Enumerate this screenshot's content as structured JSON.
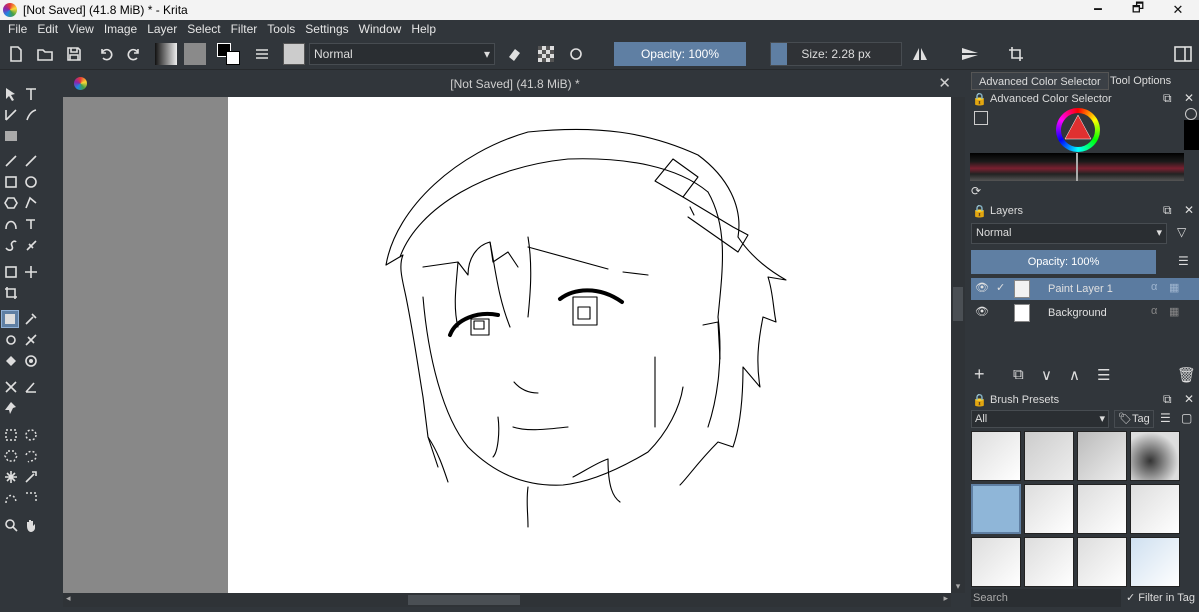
{
  "window": {
    "title": "[Not Saved]  (41.8 MiB) * - Krita",
    "minimize": "🗕",
    "maximize": "🗗",
    "close": "✕"
  },
  "menu": [
    "File",
    "Edit",
    "View",
    "Image",
    "Layer",
    "Select",
    "Filter",
    "Tools",
    "Settings",
    "Window",
    "Help"
  ],
  "toolbar": {
    "blend_mode": "Normal",
    "opacity_label": "Opacity: 100%",
    "opacity_value": 100,
    "size_label": "Size: 2.28 px"
  },
  "document": {
    "tab_title": "[Not Saved]  (41.8 MiB) *",
    "close": "✕"
  },
  "dock_tabs": [
    "Advanced Color Selector",
    "Tool Options"
  ],
  "color_selector": {
    "title": "Advanced Color Selector"
  },
  "layers": {
    "title": "Layers",
    "blend_mode": "Normal",
    "opacity_label": "Opacity: 100%",
    "items": [
      {
        "name": "Paint Layer 1",
        "selected": true
      },
      {
        "name": "Background",
        "selected": false
      }
    ]
  },
  "brush_presets": {
    "title": "Brush Presets",
    "filter": "All",
    "tag_label": "Tag",
    "search_placeholder": "Search",
    "filter_in_tag": "Filter in Tag"
  },
  "colors": {
    "accent": "#5f7fa3",
    "panel": "#31363b",
    "canvas_bg": "#888888"
  }
}
